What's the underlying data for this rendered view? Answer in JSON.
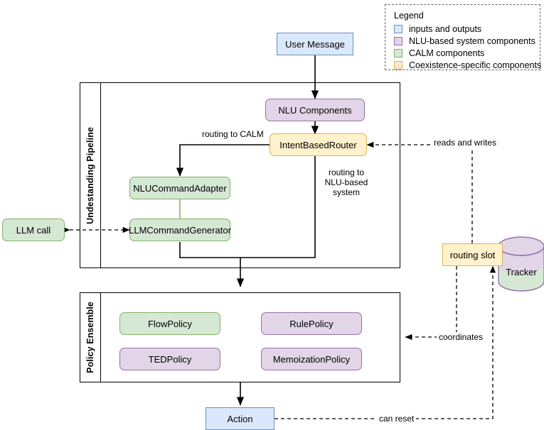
{
  "legend": {
    "title": "Legend",
    "items": [
      {
        "label": "inputs and outputs",
        "fill": "#dae8fc",
        "stroke": "#6c8ebf"
      },
      {
        "label": "NLU-based system components",
        "fill": "#e1d5e7",
        "stroke": "#9673a6"
      },
      {
        "label": "CALM components",
        "fill": "#d5e8d4",
        "stroke": "#82b366"
      },
      {
        "label": "Coexistence-specific components",
        "fill": "#ffe6cc",
        "stroke": "#d6b656"
      }
    ]
  },
  "groups": {
    "understanding_pipeline": {
      "title": "Undestanding Pipeline"
    },
    "policy_ensemble": {
      "title": "Policy Ensemble"
    }
  },
  "nodes": {
    "user_message": "User Message",
    "nlu_components": "NLU Components",
    "intent_based_router": "IntentBasedRouter",
    "nlu_command_adapter": "NLUCommandAdapter",
    "llm_command_generator": "LLMCommandGenerator",
    "llm_call": "LLM call",
    "routing_slot": "routing slot",
    "tracker": "Tracker",
    "flow_policy": "FlowPolicy",
    "rule_policy": "RulePolicy",
    "ted_policy": "TEDPolicy",
    "memoization_policy": "MemoizationPolicy",
    "action": "Action"
  },
  "edge_labels": {
    "routing_to_calm": "routing to CALM",
    "routing_to_nlu": "routing to\nNLU-based\nsystem",
    "routing_to_nlu_line1": "routing to",
    "routing_to_nlu_line2": "NLU-based",
    "routing_to_nlu_line3": "system",
    "reads_and_writes": "reads and writes",
    "coordinates": "coordinates",
    "can_reset": "can reset"
  },
  "colors": {
    "blue_fill": "#dae8fc",
    "blue_stroke": "#6c8ebf",
    "purple_fill": "#e1d5e7",
    "purple_stroke": "#9673a6",
    "green_fill": "#d5e8d4",
    "green_stroke": "#82b366",
    "yellow_fill": "#fff2cc",
    "yellow_stroke": "#d6b656",
    "line": "#000000"
  }
}
